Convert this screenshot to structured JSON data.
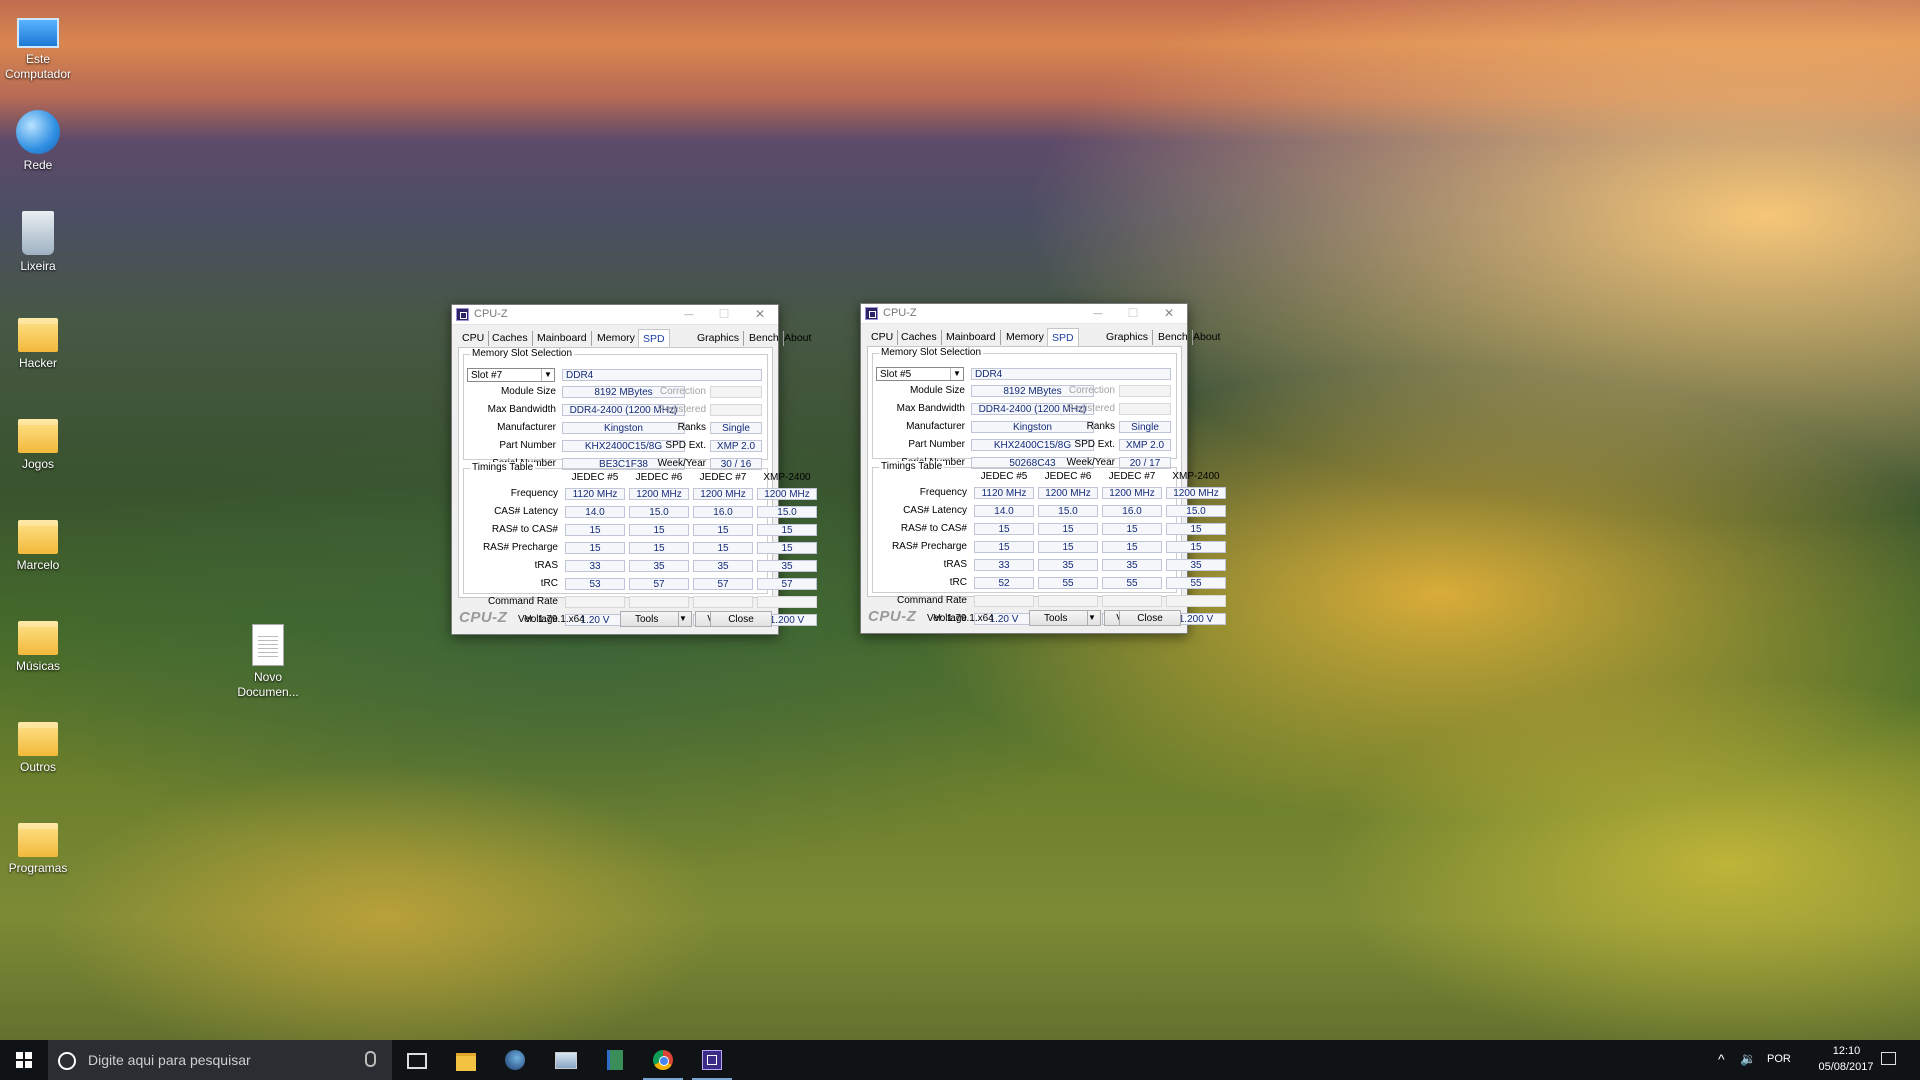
{
  "desktop": {
    "icons": [
      {
        "label": "Este\nComputador",
        "kind": "pc"
      },
      {
        "label": "Rede",
        "kind": "net"
      },
      {
        "label": "Lixeira",
        "kind": "bin"
      },
      {
        "label": "Hacker",
        "kind": "folder"
      },
      {
        "label": "Jogos",
        "kind": "folder"
      },
      {
        "label": "Marcelo",
        "kind": "folder"
      },
      {
        "label": "Músicas",
        "kind": "folder"
      },
      {
        "label": "Outros",
        "kind": "folder"
      },
      {
        "label": "Programas",
        "kind": "folder"
      }
    ],
    "doc_icon": {
      "label_line1": "Novo",
      "label_line2": "Documen..."
    }
  },
  "windows": [
    {
      "title": "CPU-Z",
      "tabs": [
        "CPU",
        "Caches",
        "Mainboard",
        "Memory",
        "SPD",
        "Graphics",
        "Bench",
        "About"
      ],
      "active_tab": "SPD",
      "slot_group_label": "Memory Slot Selection",
      "slot": "Slot #7",
      "mem_type": "DDR4",
      "module_size_label": "Module Size",
      "module_size": "8192 MBytes",
      "max_bw_label": "Max Bandwidth",
      "max_bw": "DDR4-2400 (1200 MHz)",
      "manufacturer_label": "Manufacturer",
      "manufacturer": "Kingston",
      "part_label": "Part Number",
      "part_number": "KHX2400C15/8G",
      "serial_label": "Serial Number",
      "serial_number": "BE3C1F38",
      "correction_label": "Correction",
      "registered_label": "Registered",
      "ranks_label": "Ranks",
      "ranks": "Single",
      "spdext_label": "SPD Ext.",
      "spd_ext": "XMP 2.0",
      "weekyear_label": "Week/Year",
      "week_year": "30 / 16",
      "timings_label": "Timings Table",
      "columns": [
        "JEDEC #5",
        "JEDEC #6",
        "JEDEC #7",
        "XMP-2400"
      ],
      "rows": [
        {
          "label": "Frequency",
          "values": [
            "1120 MHz",
            "1200 MHz",
            "1200 MHz",
            "1200 MHz"
          ]
        },
        {
          "label": "CAS# Latency",
          "values": [
            "14.0",
            "15.0",
            "16.0",
            "15.0"
          ]
        },
        {
          "label": "RAS# to CAS#",
          "values": [
            "15",
            "15",
            "15",
            "15"
          ]
        },
        {
          "label": "RAS# Precharge",
          "values": [
            "15",
            "15",
            "15",
            "15"
          ]
        },
        {
          "label": "tRAS",
          "values": [
            "33",
            "35",
            "35",
            "35"
          ]
        },
        {
          "label": "tRC",
          "values": [
            "53",
            "57",
            "57",
            "57"
          ]
        },
        {
          "label": "Command Rate",
          "values": [
            "",
            "",
            "",
            ""
          ]
        },
        {
          "label": "Voltage",
          "values": [
            "1.20 V",
            "1.20 V",
            "1.20 V",
            "1.200 V"
          ]
        }
      ],
      "logo": "CPU-Z",
      "version": "Ver. 1.79.1.x64",
      "tools_label": "Tools",
      "validate_label": "Validate",
      "close_label": "Close"
    },
    {
      "title": "CPU-Z",
      "tabs": [
        "CPU",
        "Caches",
        "Mainboard",
        "Memory",
        "SPD",
        "Graphics",
        "Bench",
        "About"
      ],
      "active_tab": "SPD",
      "slot_group_label": "Memory Slot Selection",
      "slot": "Slot #5",
      "mem_type": "DDR4",
      "module_size_label": "Module Size",
      "module_size": "8192 MBytes",
      "max_bw_label": "Max Bandwidth",
      "max_bw": "DDR4-2400 (1200 MHz)",
      "manufacturer_label": "Manufacturer",
      "manufacturer": "Kingston",
      "part_label": "Part Number",
      "part_number": "KHX2400C15/8G",
      "serial_label": "Serial Number",
      "serial_number": "50268C43",
      "correction_label": "Correction",
      "registered_label": "Registered",
      "ranks_label": "Ranks",
      "ranks": "Single",
      "spdext_label": "SPD Ext.",
      "spd_ext": "XMP 2.0",
      "weekyear_label": "Week/Year",
      "week_year": "20 / 17",
      "timings_label": "Timings Table",
      "columns": [
        "JEDEC #5",
        "JEDEC #6",
        "JEDEC #7",
        "XMP-2400"
      ],
      "rows": [
        {
          "label": "Frequency",
          "values": [
            "1120 MHz",
            "1200 MHz",
            "1200 MHz",
            "1200 MHz"
          ]
        },
        {
          "label": "CAS# Latency",
          "values": [
            "14.0",
            "15.0",
            "16.0",
            "15.0"
          ]
        },
        {
          "label": "RAS# to CAS#",
          "values": [
            "15",
            "15",
            "15",
            "15"
          ]
        },
        {
          "label": "RAS# Precharge",
          "values": [
            "15",
            "15",
            "15",
            "15"
          ]
        },
        {
          "label": "tRAS",
          "values": [
            "33",
            "35",
            "35",
            "35"
          ]
        },
        {
          "label": "tRC",
          "values": [
            "52",
            "55",
            "55",
            "55"
          ]
        },
        {
          "label": "Command Rate",
          "values": [
            "",
            "",
            "",
            ""
          ]
        },
        {
          "label": "Voltage",
          "values": [
            "1.20 V",
            "1.20 V",
            "1.20 V",
            "1.200 V"
          ]
        }
      ],
      "logo": "CPU-Z",
      "version": "Ver. 1.79.1.x64",
      "tools_label": "Tools",
      "validate_label": "Validate",
      "close_label": "Close"
    }
  ],
  "taskbar": {
    "search_placeholder": "Digite aqui para pesquisar",
    "pinned": [
      "task-view-icon",
      "file-explorer-icon",
      "steam-icon",
      "control-panel-icon",
      "notepad-icon",
      "chrome-icon",
      "cpuz-icon"
    ],
    "language": "POR",
    "time": "12:10",
    "date": "05/08/2017"
  }
}
